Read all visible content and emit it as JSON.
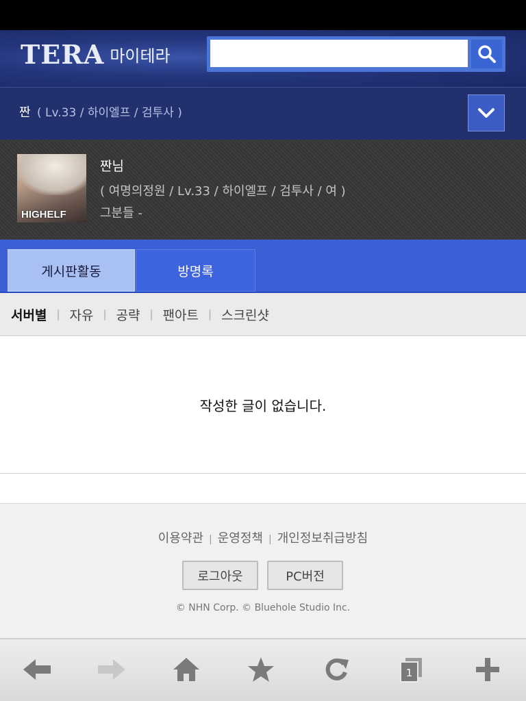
{
  "header": {
    "logo_main": "TERA",
    "logo_sub": "마이테라",
    "search_placeholder": ""
  },
  "character_bar": {
    "name": "짠",
    "info": "( Lv.33 / 하이엘프 / 검투사 )"
  },
  "profile": {
    "avatar_label": "HIGHELF",
    "name": "짠님",
    "info": "( 여명의정원 / Lv.33 / 하이엘프 / 검투사 / 여 )",
    "guild": "그분들  -"
  },
  "tabs": [
    {
      "label": "게시판활동",
      "active": true
    },
    {
      "label": "방명록",
      "active": false
    }
  ],
  "subnav": {
    "items": [
      "서버별",
      "자유",
      "공략",
      "팬아트",
      "스크린샷"
    ],
    "active": "서버별"
  },
  "content": {
    "empty_message": "작성한 글이 없습니다."
  },
  "footer": {
    "links": [
      "이용약관",
      "운영정책",
      "개인정보취급방침"
    ],
    "logout_label": "로그아웃",
    "pc_label": "PC버전",
    "copyright": "© NHN Corp.  © Bluehole Studio Inc."
  },
  "browser": {
    "tab_count": "1",
    "icons": [
      "back-icon",
      "forward-icon",
      "home-icon",
      "bookmark-star-icon",
      "refresh-icon",
      "tabs-icon",
      "add-icon"
    ]
  },
  "colors": {
    "header_bg": "#1d2c6b",
    "tab_bar": "#3c5fd6",
    "tab_active": "#a8c0f2"
  }
}
